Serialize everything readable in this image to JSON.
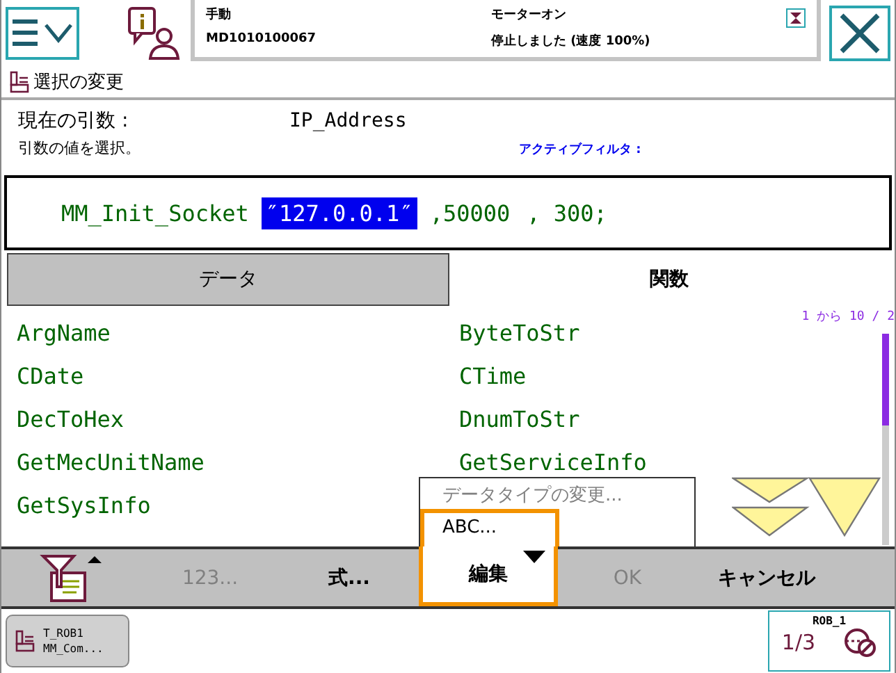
{
  "status": {
    "mode": "手動",
    "controller": "MD1010100067",
    "motor": "モーターオン",
    "state": "停止しました (速度 100%)"
  },
  "title": "選択の変更",
  "current_argument": {
    "label": "現在の引数 :",
    "value": "IP_Address"
  },
  "instruction": "引数の値を選択。",
  "active_filter": {
    "label": "アクティブフィルタ :"
  },
  "statement": [
    {
      "text": "MM_Init_Socket",
      "selected": false
    },
    {
      "text": "″127.0.0.1″",
      "selected": true
    },
    {
      "text": ",50000",
      "selected": false
    },
    {
      "text": ", 300;",
      "selected": false
    }
  ],
  "tabs": [
    {
      "label": "データ",
      "selected": false
    },
    {
      "label": "関数",
      "selected": true
    }
  ],
  "page_info": "1 から 10 / 2",
  "items": [
    "ArgName",
    "ByteToStr",
    "CDate",
    "CTime",
    "DecToHex",
    "DnumToStr",
    "GetMecUnitName",
    "GetServiceInfo",
    "GetSysInfo"
  ],
  "popup": [
    {
      "label": "データタイプの変更...",
      "disabled": true
    },
    {
      "label": "ABC...",
      "disabled": false
    }
  ],
  "toolbar": [
    {
      "label": "123...",
      "kind": "button",
      "disabled": true,
      "expanded": false
    },
    {
      "label": "式...",
      "kind": "button",
      "disabled": false,
      "expanded": false
    },
    {
      "label": "編集",
      "kind": "menu",
      "disabled": false,
      "expanded": true
    },
    {
      "label": "OK",
      "kind": "button",
      "disabled": true,
      "expanded": false
    },
    {
      "label": "キャンセル",
      "kind": "button",
      "disabled": false,
      "expanded": false
    }
  ],
  "taskbar": [
    {
      "task": "T_ROB1",
      "module": "MM_Com..."
    }
  ],
  "robot": {
    "name": "ROB_1",
    "increment": "1/3"
  }
}
